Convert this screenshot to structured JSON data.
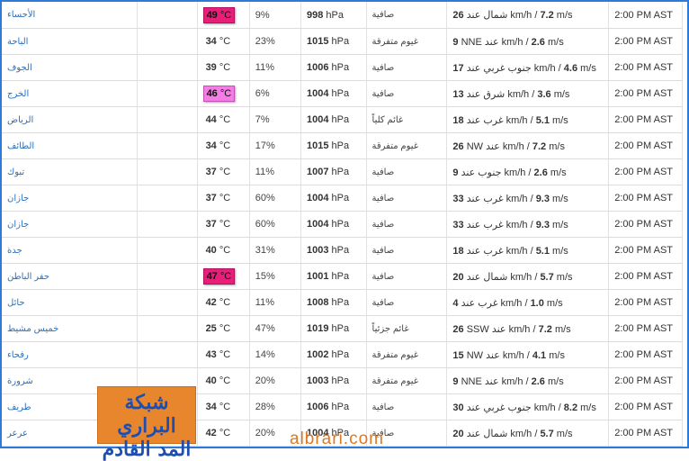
{
  "rows": [
    {
      "city": "الأحساء",
      "temp": "49",
      "temp_unit": "°C",
      "hot": "red",
      "humidity": "9%",
      "pressure": "998",
      "pressure_unit": "hPa",
      "condition": "صافية",
      "wind_speed_kmh": "26",
      "wind_dir": "شمال عند",
      "wind_unit_kmh": "km/h /",
      "wind_speed_ms": "7.2",
      "wind_unit_ms": "m/s",
      "time": "2:00 PM AST"
    },
    {
      "city": "الباحة",
      "temp": "34",
      "temp_unit": "°C",
      "hot": "",
      "humidity": "23%",
      "pressure": "1015",
      "pressure_unit": "hPa",
      "condition": "غيوم متفرقة",
      "wind_speed_kmh": "9",
      "wind_dir": "NNE عند",
      "wind_unit_kmh": "km/h /",
      "wind_speed_ms": "2.6",
      "wind_unit_ms": "m/s",
      "time": "2:00 PM AST"
    },
    {
      "city": "الجوف",
      "temp": "39",
      "temp_unit": "°C",
      "hot": "",
      "humidity": "11%",
      "pressure": "1006",
      "pressure_unit": "hPa",
      "condition": "صافية",
      "wind_speed_kmh": "17",
      "wind_dir": "جنوب غربي عند",
      "wind_unit_kmh": "km/h /",
      "wind_speed_ms": "4.6",
      "wind_unit_ms": "m/s",
      "time": "2:00 PM AST"
    },
    {
      "city": "الخرج",
      "temp": "46",
      "temp_unit": "°C",
      "hot": "pink",
      "humidity": "6%",
      "pressure": "1004",
      "pressure_unit": "hPa",
      "condition": "صافية",
      "wind_speed_kmh": "13",
      "wind_dir": "شرق عند",
      "wind_unit_kmh": "km/h /",
      "wind_speed_ms": "3.6",
      "wind_unit_ms": "m/s",
      "time": "2:00 PM AST"
    },
    {
      "city": "الرياض",
      "temp": "44",
      "temp_unit": "°C",
      "hot": "",
      "humidity": "7%",
      "pressure": "1004",
      "pressure_unit": "hPa",
      "condition": "غائم كلياً",
      "wind_speed_kmh": "18",
      "wind_dir": "غرب عند",
      "wind_unit_kmh": "km/h /",
      "wind_speed_ms": "5.1",
      "wind_unit_ms": "m/s",
      "time": "2:00 PM AST"
    },
    {
      "city": "الطائف",
      "temp": "34",
      "temp_unit": "°C",
      "hot": "",
      "humidity": "17%",
      "pressure": "1015",
      "pressure_unit": "hPa",
      "condition": "غيوم متفرقة",
      "wind_speed_kmh": "26",
      "wind_dir": "NW عند",
      "wind_unit_kmh": "km/h /",
      "wind_speed_ms": "7.2",
      "wind_unit_ms": "m/s",
      "time": "2:00 PM AST"
    },
    {
      "city": "تبوك",
      "temp": "37",
      "temp_unit": "°C",
      "hot": "",
      "humidity": "11%",
      "pressure": "1007",
      "pressure_unit": "hPa",
      "condition": "صافية",
      "wind_speed_kmh": "9",
      "wind_dir": "جنوب عند",
      "wind_unit_kmh": "km/h /",
      "wind_speed_ms": "2.6",
      "wind_unit_ms": "m/s",
      "time": "2:00 PM AST"
    },
    {
      "city": "جازان",
      "temp": "37",
      "temp_unit": "°C",
      "hot": "",
      "humidity": "60%",
      "pressure": "1004",
      "pressure_unit": "hPa",
      "condition": "صافية",
      "wind_speed_kmh": "33",
      "wind_dir": "غرب عند",
      "wind_unit_kmh": "km/h /",
      "wind_speed_ms": "9.3",
      "wind_unit_ms": "m/s",
      "time": "2:00 PM AST"
    },
    {
      "city": "جازان",
      "temp": "37",
      "temp_unit": "°C",
      "hot": "",
      "humidity": "60%",
      "pressure": "1004",
      "pressure_unit": "hPa",
      "condition": "صافية",
      "wind_speed_kmh": "33",
      "wind_dir": "غرب عند",
      "wind_unit_kmh": "km/h /",
      "wind_speed_ms": "9.3",
      "wind_unit_ms": "m/s",
      "time": "2:00 PM AST"
    },
    {
      "city": "جدة",
      "temp": "40",
      "temp_unit": "°C",
      "hot": "",
      "humidity": "31%",
      "pressure": "1003",
      "pressure_unit": "hPa",
      "condition": "صافية",
      "wind_speed_kmh": "18",
      "wind_dir": "غرب عند",
      "wind_unit_kmh": "km/h /",
      "wind_speed_ms": "5.1",
      "wind_unit_ms": "m/s",
      "time": "2:00 PM AST"
    },
    {
      "city": "حفر الباطن",
      "temp": "47",
      "temp_unit": "°C",
      "hot": "red",
      "humidity": "15%",
      "pressure": "1001",
      "pressure_unit": "hPa",
      "condition": "صافية",
      "wind_speed_kmh": "20",
      "wind_dir": "شمال عند",
      "wind_unit_kmh": "km/h /",
      "wind_speed_ms": "5.7",
      "wind_unit_ms": "m/s",
      "time": "2:00 PM AST"
    },
    {
      "city": "حائل",
      "temp": "42",
      "temp_unit": "°C",
      "hot": "",
      "humidity": "11%",
      "pressure": "1008",
      "pressure_unit": "hPa",
      "condition": "صافية",
      "wind_speed_kmh": "4",
      "wind_dir": "غرب عند",
      "wind_unit_kmh": "km/h /",
      "wind_speed_ms": "1.0",
      "wind_unit_ms": "m/s",
      "time": "2:00 PM AST"
    },
    {
      "city": "خميس مشيط",
      "temp": "25",
      "temp_unit": "°C",
      "hot": "",
      "humidity": "47%",
      "pressure": "1019",
      "pressure_unit": "hPa",
      "condition": "غائم جزئياً",
      "wind_speed_kmh": "26",
      "wind_dir": "SSW عند",
      "wind_unit_kmh": "km/h /",
      "wind_speed_ms": "7.2",
      "wind_unit_ms": "m/s",
      "time": "2:00 PM AST"
    },
    {
      "city": "رفحاء",
      "temp": "43",
      "temp_unit": "°C",
      "hot": "",
      "humidity": "14%",
      "pressure": "1002",
      "pressure_unit": "hPa",
      "condition": "غيوم متفرقة",
      "wind_speed_kmh": "15",
      "wind_dir": "NW عند",
      "wind_unit_kmh": "km/h /",
      "wind_speed_ms": "4.1",
      "wind_unit_ms": "m/s",
      "time": "2:00 PM AST"
    },
    {
      "city": "شرورة",
      "temp": "40",
      "temp_unit": "°C",
      "hot": "",
      "humidity": "20%",
      "pressure": "1003",
      "pressure_unit": "hPa",
      "condition": "غيوم متفرقة",
      "wind_speed_kmh": "9",
      "wind_dir": "NNE عند",
      "wind_unit_kmh": "km/h /",
      "wind_speed_ms": "2.6",
      "wind_unit_ms": "m/s",
      "time": "2:00 PM AST"
    },
    {
      "city": "طريف",
      "temp": "34",
      "temp_unit": "°C",
      "hot": "",
      "humidity": "28%",
      "pressure": "1006",
      "pressure_unit": "hPa",
      "condition": "صافية",
      "wind_speed_kmh": "30",
      "wind_dir": "جنوب غربي عند",
      "wind_unit_kmh": "km/h /",
      "wind_speed_ms": "8.2",
      "wind_unit_ms": "m/s",
      "time": "2:00 PM AST"
    },
    {
      "city": "عرعر",
      "temp": "42",
      "temp_unit": "°C",
      "hot": "",
      "humidity": "20%",
      "pressure": "1004",
      "pressure_unit": "hPa",
      "condition": "صافية",
      "wind_speed_kmh": "20",
      "wind_dir": "شمال عند",
      "wind_unit_kmh": "km/h /",
      "wind_speed_ms": "5.7",
      "wind_unit_ms": "m/s",
      "time": "2:00 PM AST"
    }
  ],
  "logo": {
    "line1": "شبكة البراري",
    "line2": "المد القادم"
  },
  "watermark": "albrari.com",
  "colors": {
    "hot_red": "#e91e78",
    "hot_pink": "#f57be6",
    "frame": "#2f7ad8",
    "city_link": "#2a6fbf",
    "watermark": "#e07820",
    "logo_bg": "#e8862d"
  }
}
